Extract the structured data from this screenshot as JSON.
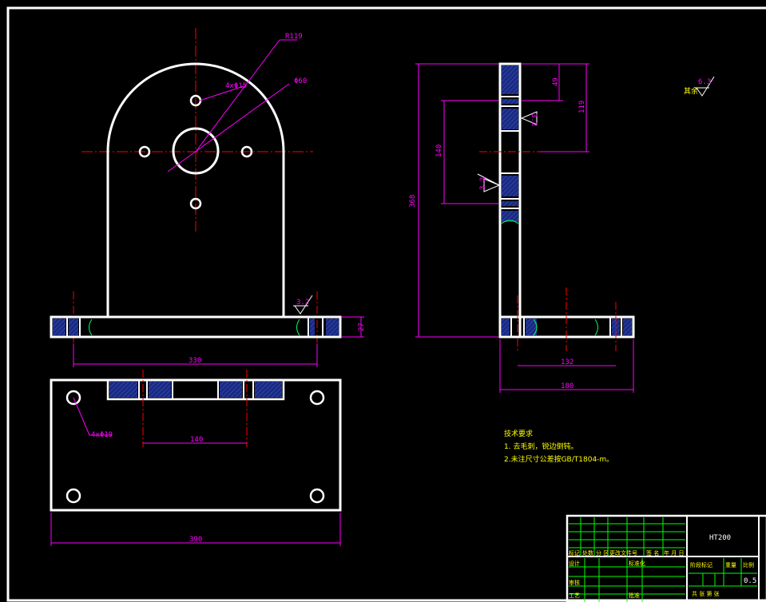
{
  "colors": {
    "background": "#000000",
    "outline": "#ffffff",
    "centerline": "#ff0000",
    "dimension": "#ff00ff",
    "note_text": "#ffff00",
    "hatch": "#1a2a80",
    "table_grid": "#00ff00",
    "break_line": "#00ff66"
  },
  "front_view": {
    "arc_radius": "R119",
    "bolt_holes": "4xΦ15",
    "center_bore": "Φ60",
    "base_height": "27",
    "roughness_base": "3.2",
    "width_hole_spacing": "330"
  },
  "top_view": {
    "corner_holes": "4xΦ19",
    "slot_width": "140",
    "overall_width": "390"
  },
  "side_view": {
    "overall_height": "368",
    "top_offset": "49",
    "center_height": "119",
    "bolt_span": "140",
    "roughness_1": "3.2",
    "roughness_2": "3.2",
    "base_hole_spacing": "132",
    "overall_depth": "180"
  },
  "general_roughness": {
    "label": "其余",
    "value": "6.3"
  },
  "tech_requirements": {
    "title": "技术要求",
    "line1": "1. 去毛刺，锐边倒钝。",
    "line2": "2.未注尺寸公差按GB/T1804-m。"
  },
  "title_block": {
    "material": "HT200",
    "scale": "0.5",
    "h_mark": "标记",
    "h_count": "处数",
    "h_zone": "分 区",
    "h_doc": "更改文件号",
    "h_sign": "签 名",
    "h_date": "年 月 日",
    "r_design": "设计",
    "r_std": "标准化",
    "r_audit": "审核",
    "r_process": "工艺",
    "r_approve": "批准",
    "stage_mark": "阶段标记",
    "weight": "重量",
    "scale_label": "比例",
    "sheets": "共  张  第  张"
  }
}
